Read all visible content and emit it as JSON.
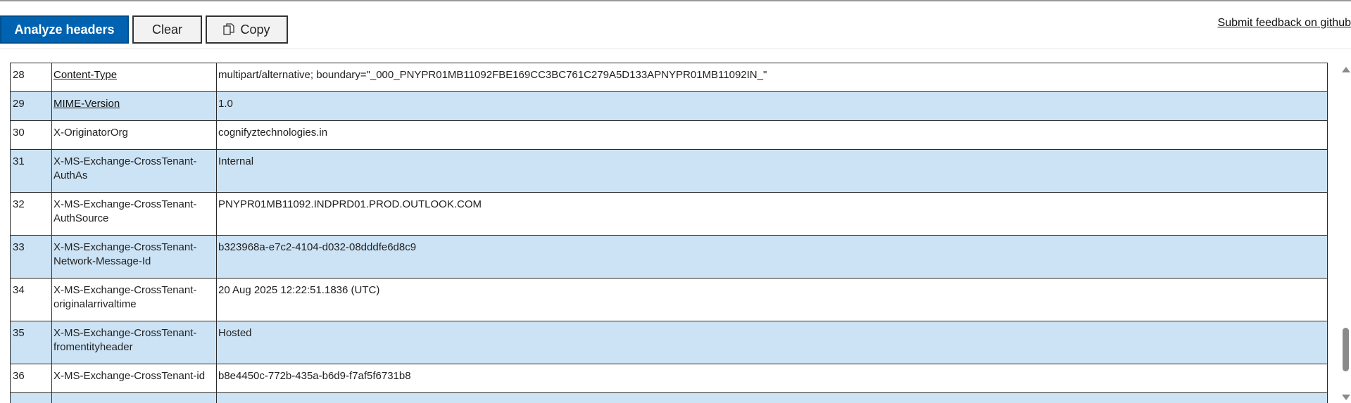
{
  "toolbar": {
    "analyze_label": "Analyze headers",
    "clear_label": "Clear",
    "copy_label": "Copy",
    "feedback_label": "Submit feedback on github"
  },
  "rows": [
    {
      "num": "28",
      "header": "Content-Type",
      "value": "multipart/alternative; boundary=\"_000_PNYPR01MB11092FBE169CC3BC761C279A5D133APNYPR01MB11092IN_\"",
      "link": true
    },
    {
      "num": "29",
      "header": "MIME-Version",
      "value": "1.0",
      "link": true
    },
    {
      "num": "30",
      "header": "X-OriginatorOrg",
      "value": "cognifyztechnologies.in",
      "link": false
    },
    {
      "num": "31",
      "header": "X-MS-Exchange-CrossTenant-AuthAs",
      "value": "Internal",
      "link": false
    },
    {
      "num": "32",
      "header": "X-MS-Exchange-CrossTenant-AuthSource",
      "value": "PNYPR01MB11092.INDPRD01.PROD.OUTLOOK.COM",
      "link": false
    },
    {
      "num": "33",
      "header": "X-MS-Exchange-CrossTenant-Network-Message-Id",
      "value": "b323968a-e7c2-4104-d032-08dddfe6d8c9",
      "link": false
    },
    {
      "num": "34",
      "header": "X-MS-Exchange-CrossTenant-originalarrivaltime",
      "value": "20 Aug 2025 12:22:51.1836 (UTC)",
      "link": false
    },
    {
      "num": "35",
      "header": "X-MS-Exchange-CrossTenant-fromentityheader",
      "value": "Hosted",
      "link": false
    },
    {
      "num": "36",
      "header": "X-MS-Exchange-CrossTenant-id",
      "value": "b8e4450c-772b-435a-b6d9-f7af5f6731b8",
      "link": false
    }
  ]
}
